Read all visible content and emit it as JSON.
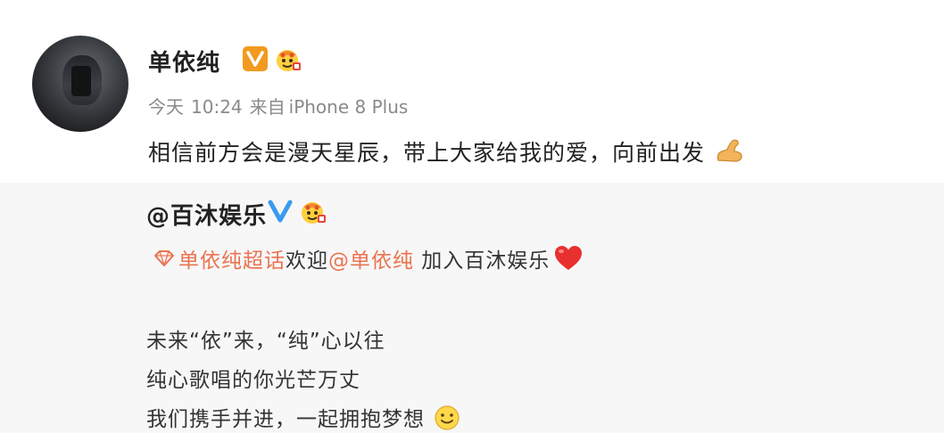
{
  "post": {
    "username": "单依纯",
    "meta": {
      "day": "今天",
      "time": "10:24",
      "source_prefix": "来自",
      "device": "iPhone 8 Plus"
    },
    "content": "相信前方会是漫天星辰，带上大家给我的爱，向前出发",
    "icons": {
      "verified_badge": "verified-v-badge-icon",
      "member_badge": "member-face-badge-icon",
      "emoji": "flexed-arm-emoji-icon"
    }
  },
  "repost": {
    "username": "@百沐娱乐",
    "topic_link": "单依纯超话",
    "welcome_text": "欢迎",
    "mention": "@单依纯",
    "join_text": " 加入百沐娱乐",
    "lines": [
      "未来“依”来，“纯”心以往",
      "纯心歌唱的你光芒万丈",
      "我们携手并进，一起拥抱梦想"
    ],
    "icons": {
      "blue_badge": "blue-verified-v-icon",
      "heart": "red-heart-emoji-icon",
      "smile": "smile-emoji-icon"
    }
  },
  "colors": {
    "link": "#eb7350",
    "verified_orange": "#f29a1f",
    "verified_blue": "#3a9bf0",
    "meta_gray": "#8a8a8a",
    "repost_bg": "#f7f7f8"
  }
}
